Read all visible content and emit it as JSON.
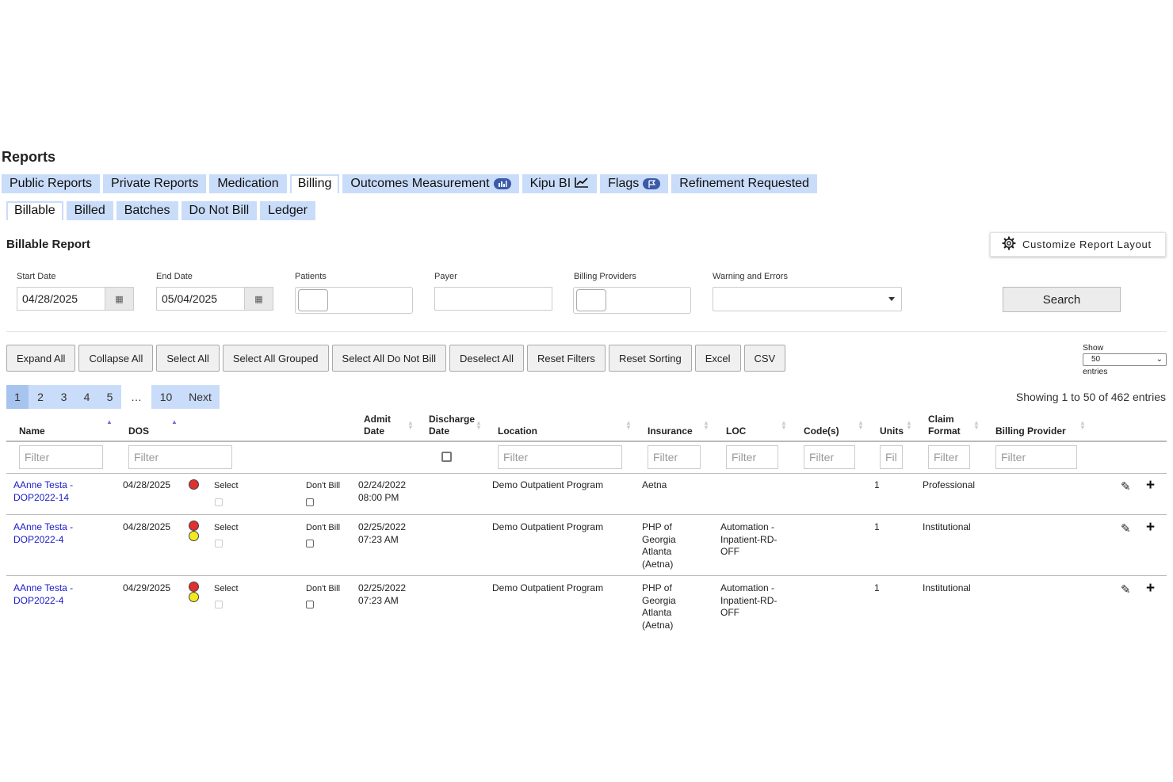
{
  "page_title": "Reports",
  "main_tabs": [
    {
      "label": "Public Reports"
    },
    {
      "label": "Private Reports"
    },
    {
      "label": "Medication"
    },
    {
      "label": "Billing"
    },
    {
      "label": "Outcomes Measurement"
    },
    {
      "label": "Kipu BI"
    },
    {
      "label": "Flags"
    },
    {
      "label": "Refinement Requested"
    }
  ],
  "sub_tabs": [
    {
      "label": "Billable"
    },
    {
      "label": "Billed"
    },
    {
      "label": "Batches"
    },
    {
      "label": "Do Not Bill"
    },
    {
      "label": "Ledger"
    }
  ],
  "section_title": "Billable Report",
  "customize_label": "Customize Report Layout",
  "fields": {
    "start_date_label": "Start Date",
    "start_date_value": "04/28/2025",
    "end_date_label": "End Date",
    "end_date_value": "05/04/2025",
    "patients_label": "Patients",
    "payer_label": "Payer",
    "billing_providers_label": "Billing Providers",
    "warnings_label": "Warning and Errors"
  },
  "search_label": "Search",
  "actions": [
    "Expand All",
    "Collapse All",
    "Select All",
    "Select All Grouped",
    "Select All Do Not Bill",
    "Deselect All",
    "Reset Filters",
    "Reset Sorting",
    "Excel",
    "CSV"
  ],
  "show_entries": {
    "show": "Show",
    "value": "50",
    "entries": "entries"
  },
  "pagination": {
    "pages": [
      "1",
      "2",
      "3",
      "4",
      "5",
      "…",
      "10",
      "Next"
    ],
    "current": "1"
  },
  "info": "Showing 1 to 50 of 462 entries",
  "table": {
    "headers": {
      "name": "Name",
      "dos": "DOS",
      "admit1": "Admit",
      "admit2": "Date",
      "discharge1": "Discharge",
      "discharge2": "Date",
      "location": "Location",
      "insurance": "Insurance",
      "loc": "LOC",
      "codes": "Code(s)",
      "units": "Units",
      "claim1": "Claim",
      "claim2": "Format",
      "billing_provider": "Billing Provider"
    },
    "filter_placeholder": "Filter",
    "units_filter_placeholder": "Fil",
    "select_label": "Select",
    "dont_bill_label": "Don't Bill",
    "rows": [
      {
        "name1": "AAnne Testa -",
        "name2": "DOP2022-14",
        "dos": "04/28/2025",
        "status": [
          "red"
        ],
        "admit1": "02/24/2022",
        "admit2": "08:00 PM",
        "location": "Demo Outpatient Program",
        "ins": [
          "Aetna"
        ],
        "loc": [],
        "units": "1",
        "claim": "Professional"
      },
      {
        "name1": "AAnne Testa -",
        "name2": "DOP2022-4",
        "dos": "04/28/2025",
        "status": [
          "red",
          "yellow"
        ],
        "admit1": "02/25/2022",
        "admit2": "07:23 AM",
        "location": "Demo Outpatient Program",
        "ins": [
          "PHP of",
          "Georgia",
          "Atlanta",
          "(Aetna)"
        ],
        "loc": [
          "Automation -",
          "Inpatient-RD-",
          "OFF"
        ],
        "units": "1",
        "claim": "Institutional"
      },
      {
        "name1": "AAnne Testa -",
        "name2": "DOP2022-4",
        "dos": "04/29/2025",
        "status": [
          "red",
          "yellow"
        ],
        "admit1": "02/25/2022",
        "admit2": "07:23 AM",
        "location": "Demo Outpatient Program",
        "ins": [
          "PHP of",
          "Georgia",
          "Atlanta",
          "(Aetna)"
        ],
        "loc": [
          "Automation -",
          "Inpatient-RD-",
          "OFF"
        ],
        "units": "1",
        "claim": "Institutional"
      }
    ]
  }
}
